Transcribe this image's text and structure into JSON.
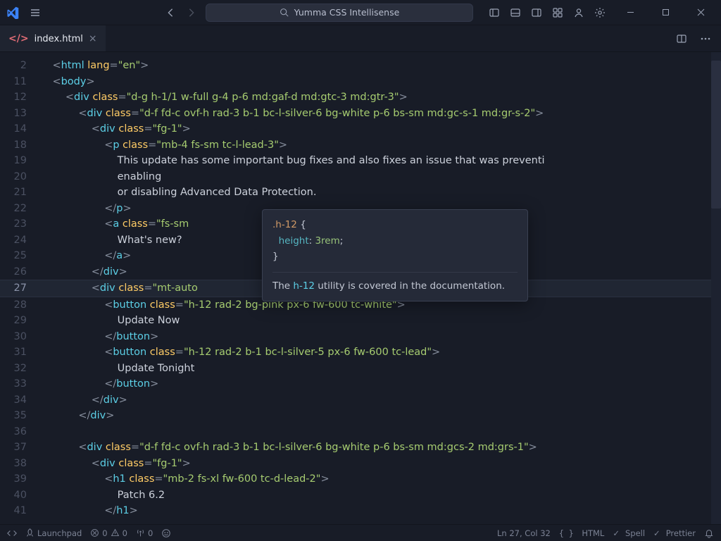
{
  "titlebar": {
    "command_center": "Yumma CSS Intellisense"
  },
  "tab": {
    "filename": "index.html"
  },
  "hover": {
    "selector": ".h-12",
    "rule_open": " {",
    "prop": "  height",
    "colon": ": ",
    "value": "3rem",
    "semi": ";",
    "close": "}",
    "doc_prefix": "The ",
    "doc_util": "h-12",
    "doc_suffix": " utility is covered in the documentation."
  },
  "lines": [
    {
      "n": "2",
      "html": "<span class='p'>&lt;</span><span class='t'>html</span> <span class='a'>lang</span><span class='p'>=</span><span class='s'>\"en\"</span><span class='p'>&gt;</span>",
      "indent": 1
    },
    {
      "n": "11",
      "html": "<span class='p'>&lt;</span><span class='t'>body</span><span class='p'>&gt;</span>",
      "indent": 1
    },
    {
      "n": "12",
      "html": "<span class='p'>&lt;</span><span class='t'>div</span> <span class='a'>class</span><span class='p'>=</span><span class='s'>\"d-g h-1/1 w-full g-4 p-6 md:gaf-d md:gtc-3 md:gtr-3\"</span><span class='p'>&gt;</span>",
      "indent": 2
    },
    {
      "n": "13",
      "html": "<span class='p'>&lt;</span><span class='t'>div</span> <span class='a'>class</span><span class='p'>=</span><span class='s'>\"d-f fd-c ovf-h rad-3 b-1 bc-l-silver-6 bg-white p-6 bs-sm md:gc-s-1 md:gr-s-2\"</span><span class='p'>&gt;</span>",
      "indent": 3
    },
    {
      "n": "14",
      "html": "<span class='p'>&lt;</span><span class='t'>div</span> <span class='a'>class</span><span class='p'>=</span><span class='s'>\"fg-1\"</span><span class='p'>&gt;</span>",
      "indent": 4,
      "current": false
    },
    {
      "n": "18",
      "html": "<span class='p'>&lt;</span><span class='t'>p</span> <span class='a'>class</span><span class='p'>=</span><span class='s'>\"mb-4 fs-sm tc-l-lead-3\"</span><span class='p'>&gt;</span>",
      "indent": 5
    },
    {
      "n": "19",
      "html": "<span class='tx'>This update has some important bug fixes and also fixes an issue that was preventi</span>",
      "indent": 6
    },
    {
      "n": "20",
      "html": "<span class='tx'>enabling</span>",
      "indent": 6
    },
    {
      "n": "21",
      "html": "<span class='tx'>or disabling Advanced Data Protection.</span>",
      "indent": 6
    },
    {
      "n": "22",
      "html": "<span class='p'>&lt;/</span><span class='t'>p</span><span class='p'>&gt;</span>",
      "indent": 5
    },
    {
      "n": "23",
      "html": "<span class='p'>&lt;</span><span class='t'>a</span> <span class='a'>class</span><span class='p'>=</span><span class='s'>\"fs-sm</span>",
      "indent": 5
    },
    {
      "n": "24",
      "html": "<span class='tx'>What's new?</span>",
      "indent": 6
    },
    {
      "n": "25",
      "html": "<span class='p'>&lt;/</span><span class='t'>a</span><span class='p'>&gt;</span>",
      "indent": 5
    },
    {
      "n": "26",
      "html": "<span class='p'>&lt;/</span><span class='t'>div</span><span class='p'>&gt;</span>",
      "indent": 4
    },
    {
      "n": "27",
      "html": "<span class='p'>&lt;</span><span class='t'>div</span> <span class='a'>class</span><span class='p'>=</span><span class='s'>\"mt-auto</span>",
      "indent": 4,
      "current": true
    },
    {
      "n": "28",
      "html": "<span class='p'>&lt;</span><span class='t'>button</span> <span class='a'>class</span><span class='p'>=</span><span class='s'>\"h-12 rad-2 bg-pink px-6 fw-600 tc-white\"</span><span class='p'>&gt;</span>",
      "indent": 5
    },
    {
      "n": "29",
      "html": "<span class='tx'>Update Now</span>",
      "indent": 6
    },
    {
      "n": "30",
      "html": "<span class='p'>&lt;/</span><span class='t'>button</span><span class='p'>&gt;</span>",
      "indent": 5
    },
    {
      "n": "31",
      "html": "<span class='p'>&lt;</span><span class='t'>button</span> <span class='a'>class</span><span class='p'>=</span><span class='s'>\"h-12 rad-2 b-1 bc-l-silver-5 px-6 fw-600 tc-lead\"</span><span class='p'>&gt;</span>",
      "indent": 5
    },
    {
      "n": "32",
      "html": "<span class='tx'>Update Tonight</span>",
      "indent": 6
    },
    {
      "n": "33",
      "html": "<span class='p'>&lt;/</span><span class='t'>button</span><span class='p'>&gt;</span>",
      "indent": 5
    },
    {
      "n": "34",
      "html": "<span class='p'>&lt;/</span><span class='t'>div</span><span class='p'>&gt;</span>",
      "indent": 4
    },
    {
      "n": "35",
      "html": "<span class='p'>&lt;/</span><span class='t'>div</span><span class='p'>&gt;</span>",
      "indent": 3
    },
    {
      "n": "36",
      "html": "",
      "indent": 0
    },
    {
      "n": "37",
      "html": "<span class='p'>&lt;</span><span class='t'>div</span> <span class='a'>class</span><span class='p'>=</span><span class='s'>\"d-f fd-c ovf-h rad-3 b-1 bc-l-silver-6 bg-white p-6 bs-sm md:gcs-2 md:grs-1\"</span><span class='p'>&gt;</span>",
      "indent": 3
    },
    {
      "n": "38",
      "html": "<span class='p'>&lt;</span><span class='t'>div</span> <span class='a'>class</span><span class='p'>=</span><span class='s'>\"fg-1\"</span><span class='p'>&gt;</span>",
      "indent": 4
    },
    {
      "n": "39",
      "html": "<span class='p'>&lt;</span><span class='t'>h1</span> <span class='a'>class</span><span class='p'>=</span><span class='s'>\"mb-2 fs-xl fw-600 tc-d-lead-2\"</span><span class='p'>&gt;</span>",
      "indent": 5
    },
    {
      "n": "40",
      "html": "<span class='tx'>Patch 6.2</span>",
      "indent": 6
    },
    {
      "n": "41",
      "html": "<span class='p'>&lt;/</span><span class='t'>h1</span><span class='p'>&gt;</span>",
      "indent": 5
    }
  ],
  "statusbar": {
    "launchpad": "Launchpad",
    "errors": "0",
    "warnings": "0",
    "ports": "0",
    "cursor": "Ln 27, Col 32",
    "lang": "HTML",
    "spell": "Spell",
    "prettier": "Prettier"
  }
}
